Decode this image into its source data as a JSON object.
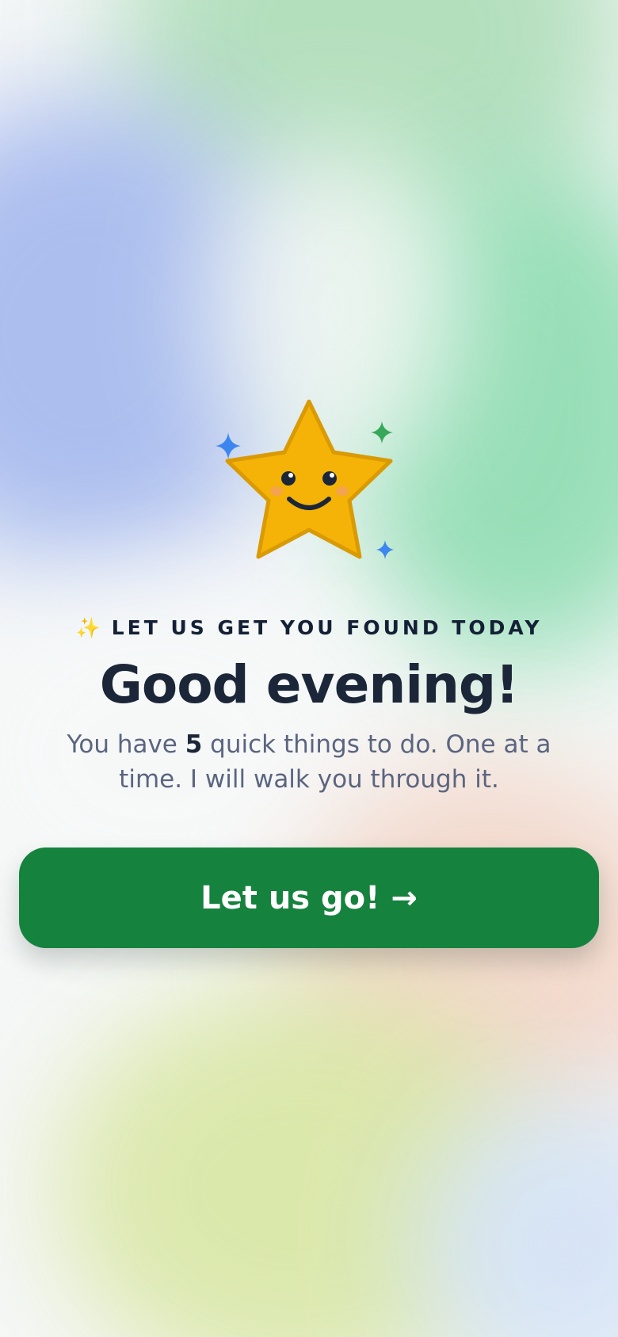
{
  "eyebrow": {
    "icon": "sparkles-icon",
    "icon_glyph": "✨",
    "text": "LET US GET YOU FOUND TODAY"
  },
  "headline": "Good evening!",
  "subtitle": {
    "prefix": "You have ",
    "count": "5",
    "suffix": " quick things to do. One at a time. I will walk you through it."
  },
  "cta": {
    "label": "Let us go! →"
  },
  "mascot": {
    "icon": "smiling-star-icon",
    "sparkles": [
      "sparkle-blue-icon",
      "sparkle-green-icon",
      "sparkle-blue-small-icon"
    ]
  },
  "colors": {
    "primary_green": "#15823e",
    "star_fill": "#f4b306",
    "star_stroke": "#d99a04",
    "sparkle_blue": "#3d86ef",
    "sparkle_green": "#37a85a",
    "heading": "#1c2639",
    "body_text": "#5b6580"
  }
}
